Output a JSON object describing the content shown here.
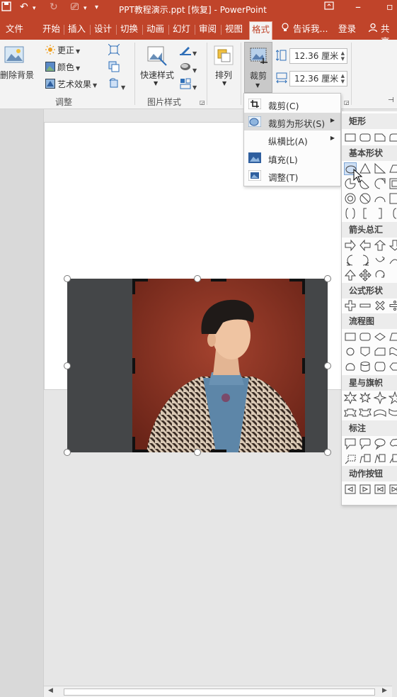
{
  "titlebar": {
    "title": "PPT教程演示.ppt [恢复] - PowerPoint",
    "color": "#c0442a"
  },
  "tabs": [
    "文件",
    "开始",
    "插入",
    "设计",
    "切换",
    "动画",
    "幻灯",
    "审阅",
    "视图",
    "格式"
  ],
  "active_tab": "格式",
  "tellme": "告诉我...",
  "login": "登录",
  "share": "共享",
  "ribbon": {
    "remove_bg": "删除背景",
    "corrections": "更正",
    "color": "颜色",
    "artistic": "艺术效果",
    "group_adjust": "调整",
    "quick_styles": "快速样式",
    "group_picture_styles": "图片样式",
    "arrange": "排列",
    "crop": "裁剪",
    "height_value": "12.36 厘米",
    "width_value": "12.36 厘米"
  },
  "crop_menu": {
    "items": [
      {
        "label": "裁剪(C)",
        "icon": "crop-icon",
        "submenu": false
      },
      {
        "label": "裁剪为形状(S)",
        "icon": "crop-to-shape-icon",
        "submenu": true,
        "highlighted": true
      },
      {
        "label": "纵横比(A)",
        "icon": "",
        "submenu": true
      },
      {
        "label": "填充(L)",
        "icon": "fill-icon",
        "submenu": false
      },
      {
        "label": "调整(T)",
        "icon": "fit-icon",
        "submenu": false
      }
    ]
  },
  "shape_gallery": {
    "categories": [
      "矩形",
      "基本形状",
      "箭头总汇",
      "公式形状",
      "流程图",
      "星与旗帜",
      "标注",
      "动作按钮"
    ]
  }
}
